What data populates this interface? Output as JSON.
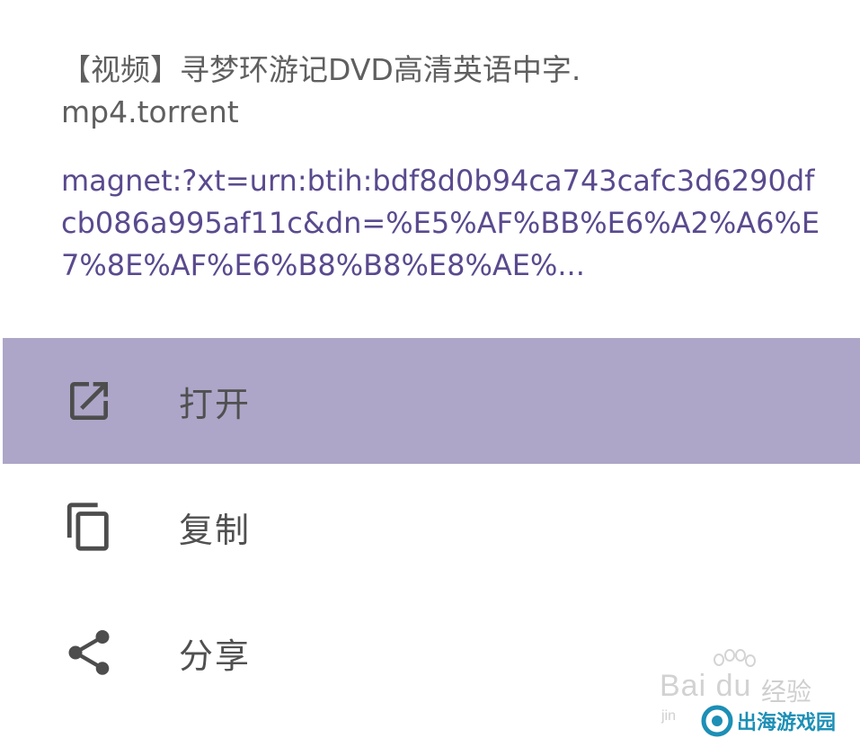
{
  "header": {
    "filename": "【视频】寻梦环游记DVD高清英语中字.mp4.torrent",
    "magnet_link": "magnet:?xt=urn:btih:bdf8d0b94ca743cafc3d6290dfcb086a995af11c&dn=%E5%AF%BB%E6%A2%A6%E7%8E%AF%E6%B8%B8%E8%AE%..."
  },
  "menu": {
    "items": [
      {
        "label": "打开",
        "icon": "open-in-new-icon",
        "active": true
      },
      {
        "label": "复制",
        "icon": "copy-icon",
        "active": false
      },
      {
        "label": "分享",
        "icon": "share-icon",
        "active": false
      }
    ]
  },
  "watermark": {
    "baidu_text": "Bai du",
    "jingyan_text": "经验",
    "jingyan_pinyin": "jin",
    "site_text": "出海游戏园"
  },
  "colors": {
    "active_row": "#ada6c8",
    "magnet_text": "#5a4a8e",
    "icon": "#4d4d4d",
    "label": "#505050"
  }
}
